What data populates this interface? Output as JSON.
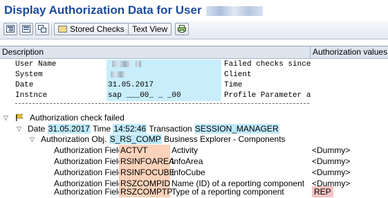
{
  "window": {
    "title": "Display Authorization Data for User"
  },
  "toolbar": {
    "icons": [
      "expand-all-icon",
      "collapse-all-icon",
      "expand-subtree-icon",
      "print-icon"
    ],
    "stored_checks": "Stored Checks",
    "text_view": "Text View"
  },
  "grid": {
    "col_description": "Description",
    "col_values": "Authorization values"
  },
  "info": {
    "rows": [
      {
        "key": "User Name",
        "value": "",
        "right": "Failed checks since"
      },
      {
        "key": "System",
        "value": "",
        "right": "Client"
      },
      {
        "key": "Date",
        "value": "31.05.2017",
        "right": "Time"
      },
      {
        "key": "Instnce",
        "value": "sap ___00_ _ _00",
        "right": "Profile Parameter a"
      }
    ]
  },
  "tree": {
    "failed": "Authorization check failed",
    "date_label": "Date",
    "date_value": "31.05.2017",
    "time_label": "Time",
    "time_value": "14:52:46",
    "transaction_label": "Transaction",
    "transaction_value": "SESSION_MANAGER",
    "obj_label": "Authorization Obj.",
    "obj_value": "S_RS_COMP",
    "obj_desc": "Business Explorer - Components",
    "field_label": "Authorization Field",
    "fields": [
      {
        "name": "ACTVT",
        "desc": "Activity",
        "value": "<Dummy>"
      },
      {
        "name": "RSINFOAREA",
        "desc": "InfoArea",
        "value": "<Dummy>"
      },
      {
        "name": "RSINFOCUBE",
        "desc": "InfoCube",
        "value": "<Dummy>"
      },
      {
        "name": "RSZCOMPID",
        "desc": "Name (ID) of a reporting component",
        "value": "<Dummy>"
      },
      {
        "name": "RSZCOMPTP",
        "desc": "Type of a reporting component",
        "value": "REP"
      }
    ]
  },
  "colors": {
    "title": "#1c4a9c",
    "value_bg": "#c8eefc",
    "field_bg": "#fbd2ba",
    "error_value_bg": "#f6c3c3"
  }
}
